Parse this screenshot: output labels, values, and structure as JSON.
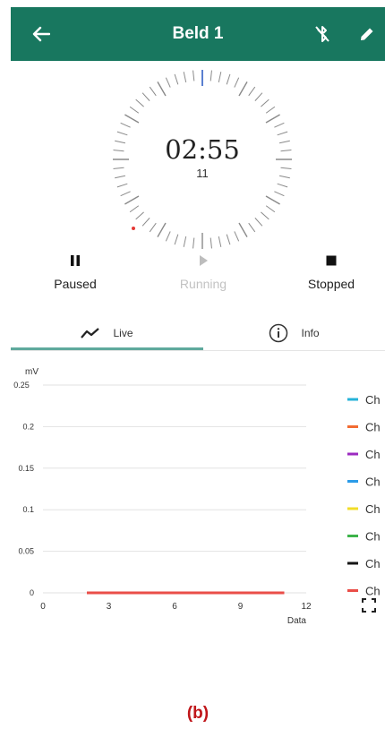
{
  "header": {
    "title": "Beld 1",
    "back_icon": "arrow-left-icon",
    "bluetooth_icon": "bluetooth-off-icon",
    "edit_icon": "pencil-icon",
    "color": "#18775f"
  },
  "timer": {
    "time": "02:55",
    "lap": "11"
  },
  "controls": {
    "paused": "Paused",
    "running": "Running",
    "stopped": "Stopped"
  },
  "tabs": {
    "live": "Live",
    "info": "Info"
  },
  "chart_data": {
    "type": "line",
    "ylabel": "mV",
    "xlabel": "Data",
    "xlim": [
      0,
      12
    ],
    "ylim": [
      0,
      0.25
    ],
    "x_ticks": [
      "0",
      "3",
      "6",
      "9",
      "12"
    ],
    "y_ticks": [
      "0.25",
      "0.2",
      "0.15",
      "0.1",
      "0.05",
      "0"
    ],
    "grid": true,
    "legend_position": "right",
    "series": [
      {
        "name": "Ch",
        "color": "#26b2d8",
        "x": [
          2,
          11
        ],
        "y": [
          0,
          0
        ]
      },
      {
        "name": "Ch",
        "color": "#f26b32",
        "x": [
          2,
          11
        ],
        "y": [
          0,
          0
        ]
      },
      {
        "name": "Ch",
        "color": "#9c2bc0",
        "x": [
          2,
          11
        ],
        "y": [
          0,
          0
        ]
      },
      {
        "name": "Ch",
        "color": "#2b9be8",
        "x": [
          2,
          11
        ],
        "y": [
          0,
          0
        ]
      },
      {
        "name": "Ch",
        "color": "#f2dd28",
        "x": [
          2,
          11
        ],
        "y": [
          0,
          0
        ]
      },
      {
        "name": "Ch",
        "color": "#3db34a",
        "x": [
          2,
          11
        ],
        "y": [
          0,
          0
        ]
      },
      {
        "name": "Ch",
        "color": "#151515",
        "x": [
          2,
          11
        ],
        "y": [
          0,
          0
        ]
      },
      {
        "name": "Ch",
        "color": "#ea4e48",
        "x": [
          2,
          11
        ],
        "y": [
          0,
          0
        ]
      }
    ]
  },
  "caption": "(b)"
}
